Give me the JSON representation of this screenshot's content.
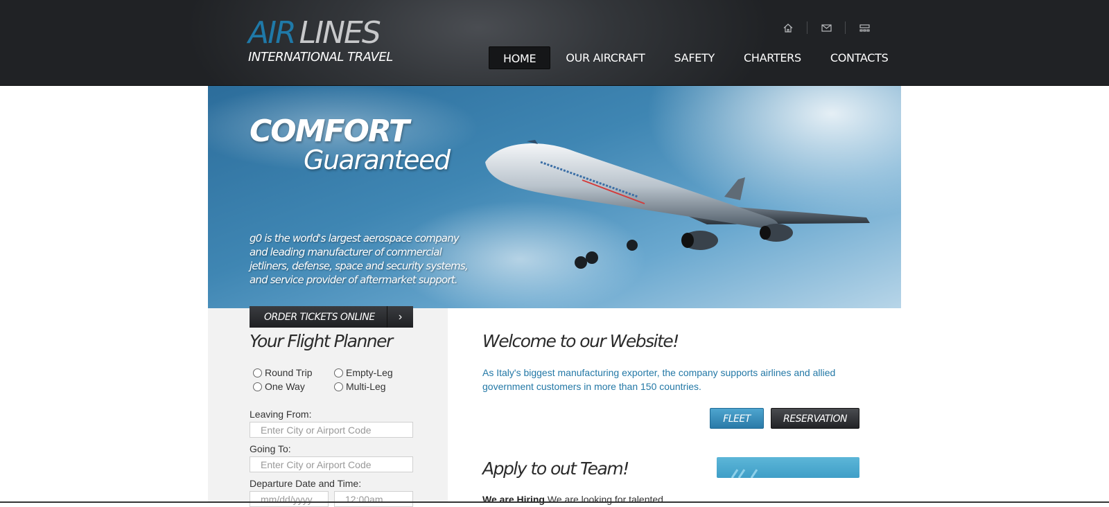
{
  "header": {
    "logo": {
      "word1": "AIR",
      "word2": "LINES",
      "subtitle": "INTERNATIONAL TRAVEL"
    },
    "util_icons": [
      "home-icon",
      "mail-icon",
      "sitemap-icon"
    ],
    "nav": [
      {
        "label": "HOME",
        "active": true
      },
      {
        "label": "OUR AIRCRAFT",
        "active": false
      },
      {
        "label": "SAFETY",
        "active": false
      },
      {
        "label": "CHARTERS",
        "active": false
      },
      {
        "label": "CONTACTS",
        "active": false
      }
    ]
  },
  "hero": {
    "title1": "COMFORT",
    "title2": "Guaranteed",
    "text": "g0 is the world's largest aerospace company and leading manufacturer of commercial jetliners, defense, space and security systems, and service provider of aftermarket support."
  },
  "planner": {
    "order_button": "ORDER TICKETS ONLINE",
    "title": "Your Flight Planner",
    "trip_types": [
      "Round Trip",
      "Empty-Leg",
      "One Way",
      "Multi-Leg"
    ],
    "leaving_label": "Leaving From:",
    "leaving_placeholder": "Enter City or Airport Code",
    "going_label": "Going To:",
    "going_placeholder": "Enter City or Airport Code",
    "departure_label": "Departure Date and Time:",
    "date_placeholder": "mm/dd/yyyy",
    "time_placeholder": "12:00am"
  },
  "content": {
    "welcome_title": "Welcome to our Website!",
    "welcome_text": "As Italy's biggest manufacturing exporter, the company supports airlines and allied government customers in more than 150 countries.",
    "fleet_button": "FLEET",
    "reservation_button": "RESERVATION",
    "apply_title": "Apply to out Team!",
    "hiring_bold": "We are Hiring",
    "hiring_text": " We are looking for talented"
  },
  "colors": {
    "header_bg": "#2a2c30",
    "accent_blue": "#1f79a8",
    "link_blue": "#2378a6",
    "panel_bg": "#f2f2f2"
  }
}
